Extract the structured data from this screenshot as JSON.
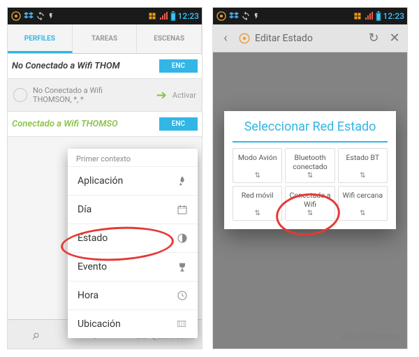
{
  "statusbar": {
    "time": "12:23"
  },
  "screen1": {
    "tabs": {
      "perfiles": "PERFILES",
      "tareas": "TAREAS",
      "escenas": "ESCENAS"
    },
    "profile1": {
      "title": "No Conectado a Wifi THOM",
      "enc": "ENC"
    },
    "profile1sub": {
      "line1": "No Conectado a Wifi",
      "line2": "THOMSON, *, *",
      "action": "Activar"
    },
    "profile2": {
      "title": "Conectado a Wifi THOMSO",
      "enc": "ENC"
    },
    "context": {
      "header": "Primer contexto",
      "items": {
        "aplicacion": "Aplicación",
        "dia": "Día",
        "estado": "Estado",
        "evento": "Evento",
        "hora": "Hora",
        "ubicacion": "Ubicación"
      }
    },
    "watermark": "LG QuickMemo"
  },
  "screen2": {
    "title": "Editar Estado",
    "dialog_title": "Seleccionar Red Estado",
    "cells": {
      "modo_avion": "Modo Avión",
      "bluetooth": "Bluetooth conectado",
      "estado_bt": "Estado BT",
      "red_movil": "Red móvil",
      "conectado_wifi": "Conectado a Wifi",
      "wifi_cercana": "Wifi cercana"
    },
    "watermark": "LG QuickMemo"
  }
}
